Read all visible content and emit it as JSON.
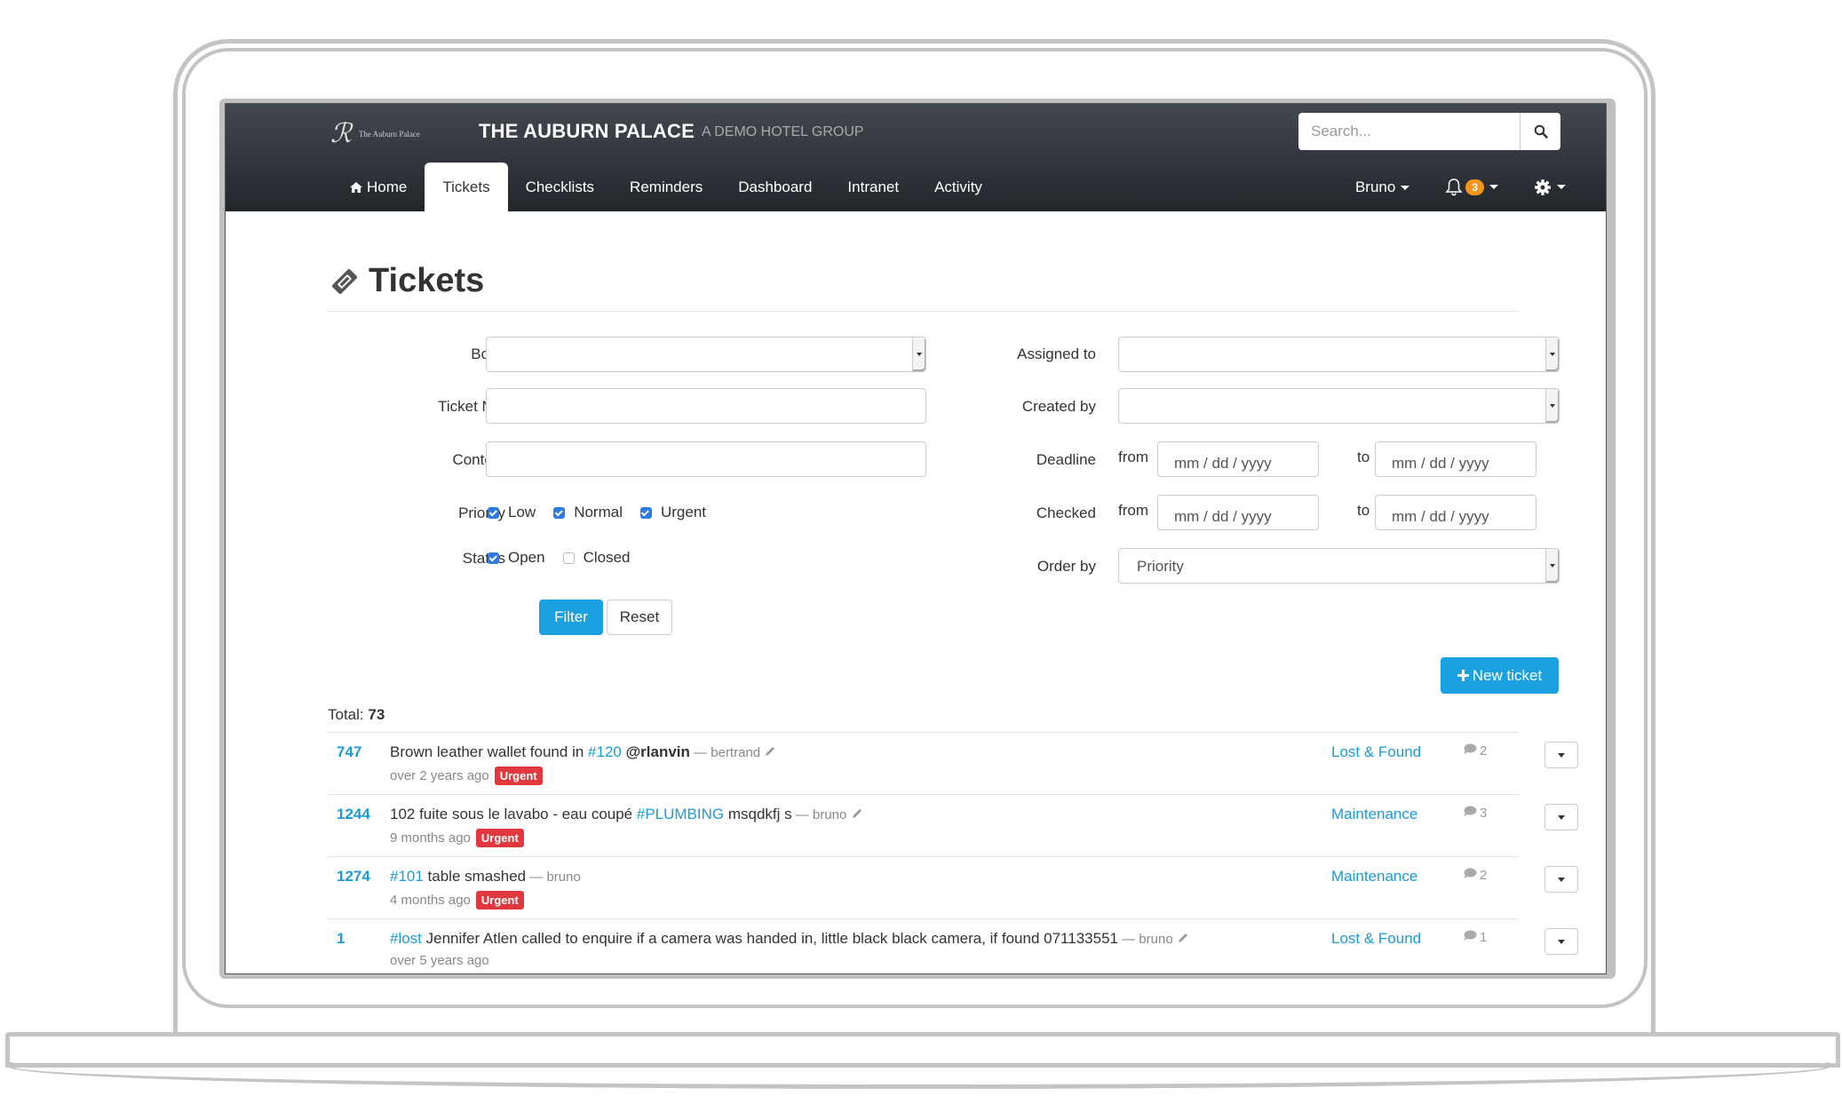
{
  "navbar": {
    "logo_text": "The Auburn Palace",
    "title": "THE AUBURN PALACE",
    "subtitle": "A DEMO HOTEL GROUP",
    "search_placeholder": "Search...",
    "nav_items": [
      {
        "label": "Home",
        "icon": "home-icon"
      },
      {
        "label": "Tickets",
        "active": true
      },
      {
        "label": "Checklists"
      },
      {
        "label": "Reminders"
      },
      {
        "label": "Dashboard"
      },
      {
        "label": "Intranet"
      },
      {
        "label": "Activity"
      }
    ],
    "user": "Bruno",
    "notifications_count": "3"
  },
  "page": {
    "title": "Tickets",
    "filters": {
      "book_label": "Book",
      "ticket_no_label": "Ticket No.",
      "content_label": "Content",
      "priority_label": "Priority",
      "priority_options": [
        {
          "label": "Low",
          "checked": true
        },
        {
          "label": "Normal",
          "checked": true
        },
        {
          "label": "Urgent",
          "checked": true
        }
      ],
      "status_label": "Status",
      "status_options": [
        {
          "label": "Open",
          "checked": true
        },
        {
          "label": "Closed",
          "checked": false
        }
      ],
      "assigned_to_label": "Assigned to",
      "created_by_label": "Created by",
      "deadline_label": "Deadline",
      "checked_label": "Checked",
      "from_label": "from",
      "to_label": "to",
      "date_placeholder": "mm / dd / yyyy",
      "order_by_label": "Order by",
      "order_by_value": "Priority",
      "filter_button": "Filter",
      "reset_button": "Reset"
    },
    "new_ticket_button": "New ticket",
    "total_label": "Total:",
    "total_value": "73"
  },
  "tickets": [
    {
      "id": "747",
      "parts": [
        {
          "t": "Brown leather wallet found in ",
          "c": ""
        },
        {
          "t": "#120",
          "c": "tag"
        },
        {
          "t": " ",
          "c": ""
        },
        {
          "t": "@rlanvin",
          "c": "mention"
        }
      ],
      "author": "— bertrand",
      "editable": true,
      "time": "over 2 years ago",
      "priority": "Urgent",
      "category": "Lost & Found",
      "comments": "2"
    },
    {
      "id": "1244",
      "parts": [
        {
          "t": "102 fuite sous le lavabo - eau coupé ",
          "c": ""
        },
        {
          "t": "#PLUMBING",
          "c": "tag"
        },
        {
          "t": " msqdkfj s",
          "c": ""
        }
      ],
      "author": "— bruno",
      "editable": true,
      "time": "9 months ago",
      "priority": "Urgent",
      "category": "Maintenance",
      "comments": "3"
    },
    {
      "id": "1274",
      "parts": [
        {
          "t": "#101",
          "c": "tag"
        },
        {
          "t": " table smashed",
          "c": ""
        }
      ],
      "author": "— bruno",
      "editable": false,
      "time": "4 months ago",
      "priority": "Urgent",
      "category": "Maintenance",
      "comments": "2"
    },
    {
      "id": "1",
      "parts": [
        {
          "t": "#lost",
          "c": "tag"
        },
        {
          "t": " Jennifer Atlen called to enquire if a camera was handed in, little black black camera, if found 071133551",
          "c": ""
        }
      ],
      "author": "— bruno",
      "editable": true,
      "time": "over 5 years ago",
      "priority": "",
      "category": "Lost & Found",
      "comments": "1"
    }
  ],
  "colors": {
    "accent": "#1ba1e2",
    "link": "#1b9bd7",
    "urgent": "#e0383e",
    "notification": "#f7941d",
    "navbar_top": "#43474f",
    "navbar_bottom": "#23262b"
  }
}
